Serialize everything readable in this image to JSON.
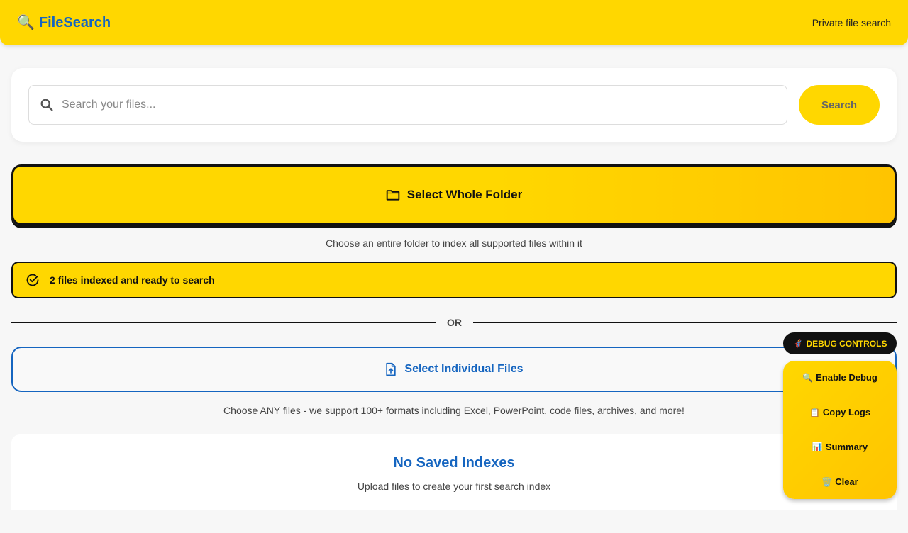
{
  "header": {
    "brand_icon": "🔍",
    "brand_name": "FileSearch",
    "tagline": "Private file search"
  },
  "search": {
    "placeholder": "Search your files...",
    "value": "",
    "button_label": "Search",
    "icon": "search-icon"
  },
  "folder_select": {
    "label": "Select Whole Folder",
    "icon": "folder-icon",
    "help": "Choose an entire folder to index all supported files within it"
  },
  "status": {
    "icon": "check-circle-icon",
    "text": "2 files indexed and ready to search"
  },
  "divider": {
    "label": "OR"
  },
  "files_select": {
    "label": "Select Individual Files",
    "icon": "file-upload-icon",
    "help": "Choose ANY files - we support 100+ formats including Excel, PowerPoint, code files, archives, and more!"
  },
  "saved_indexes": {
    "title": "No Saved Indexes",
    "subtitle": "Upload files to create your first search index"
  },
  "debug": {
    "toggle_icon": "🦸",
    "toggle_label": "DEBUG CONTROLS",
    "items": [
      {
        "icon": "🔍",
        "label": "Enable Debug"
      },
      {
        "icon": "📋",
        "label": "Copy Logs"
      },
      {
        "icon": "📊",
        "label": "Summary"
      },
      {
        "icon": "🗑️",
        "label": "Clear"
      }
    ]
  },
  "colors": {
    "accent_yellow": "#ffd700",
    "brand_blue": "#1565c0",
    "border_dark": "#111111"
  }
}
